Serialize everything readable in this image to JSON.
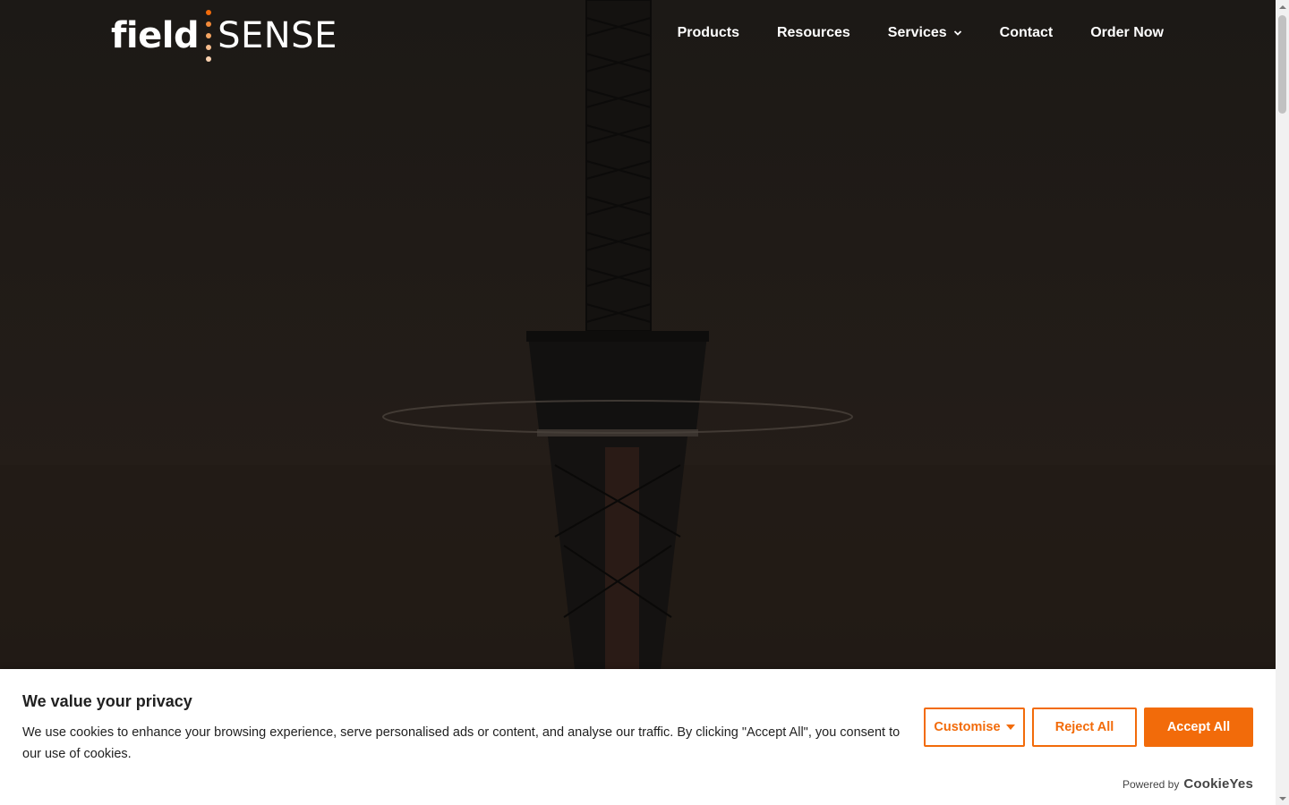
{
  "brand": {
    "logo_left": "field",
    "logo_right": "SENSE",
    "dot_colors": [
      "#f26b0a",
      "#f28a3a",
      "#f5a562",
      "#f7bd8c",
      "#f9d2b0"
    ]
  },
  "nav": {
    "items": [
      {
        "label": "Products"
      },
      {
        "label": "Resources"
      },
      {
        "label": "Services",
        "has_dropdown": true
      },
      {
        "label": "Contact"
      },
      {
        "label": "Order Now"
      }
    ]
  },
  "cookie_banner": {
    "title": "We value your privacy",
    "text": "We use cookies to enhance your browsing experience, serve personalised ads or content, and analyse our traffic. By clicking \"Accept All\", you consent to our use of cookies.",
    "customise_label": "Customise",
    "reject_label": "Reject All",
    "accept_label": "Accept All",
    "powered_by_label": "Powered by",
    "powered_by_brand": "CookieYes"
  },
  "colors": {
    "accent": "#f26b0a",
    "hero_background": "#1d1915"
  },
  "scrollbar": {
    "position_fraction": 0.0
  }
}
